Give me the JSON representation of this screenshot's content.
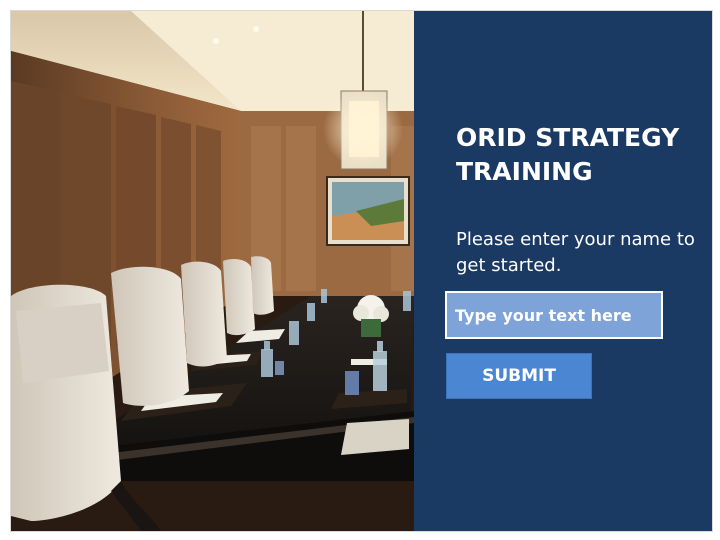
{
  "slide": {
    "title": "ORID STRATEGY TRAINING",
    "prompt": "Please enter your name to get started.",
    "name_input": {
      "placeholder": "Type your text here",
      "value": ""
    },
    "submit_label": "SUBMIT"
  },
  "photo": {
    "description_name": "conference-room-photo"
  },
  "colors": {
    "panel_background": "#1b3a63",
    "input_background": "#7ea3d8",
    "button_background": "#4a86d1",
    "text": "#ffffff"
  }
}
